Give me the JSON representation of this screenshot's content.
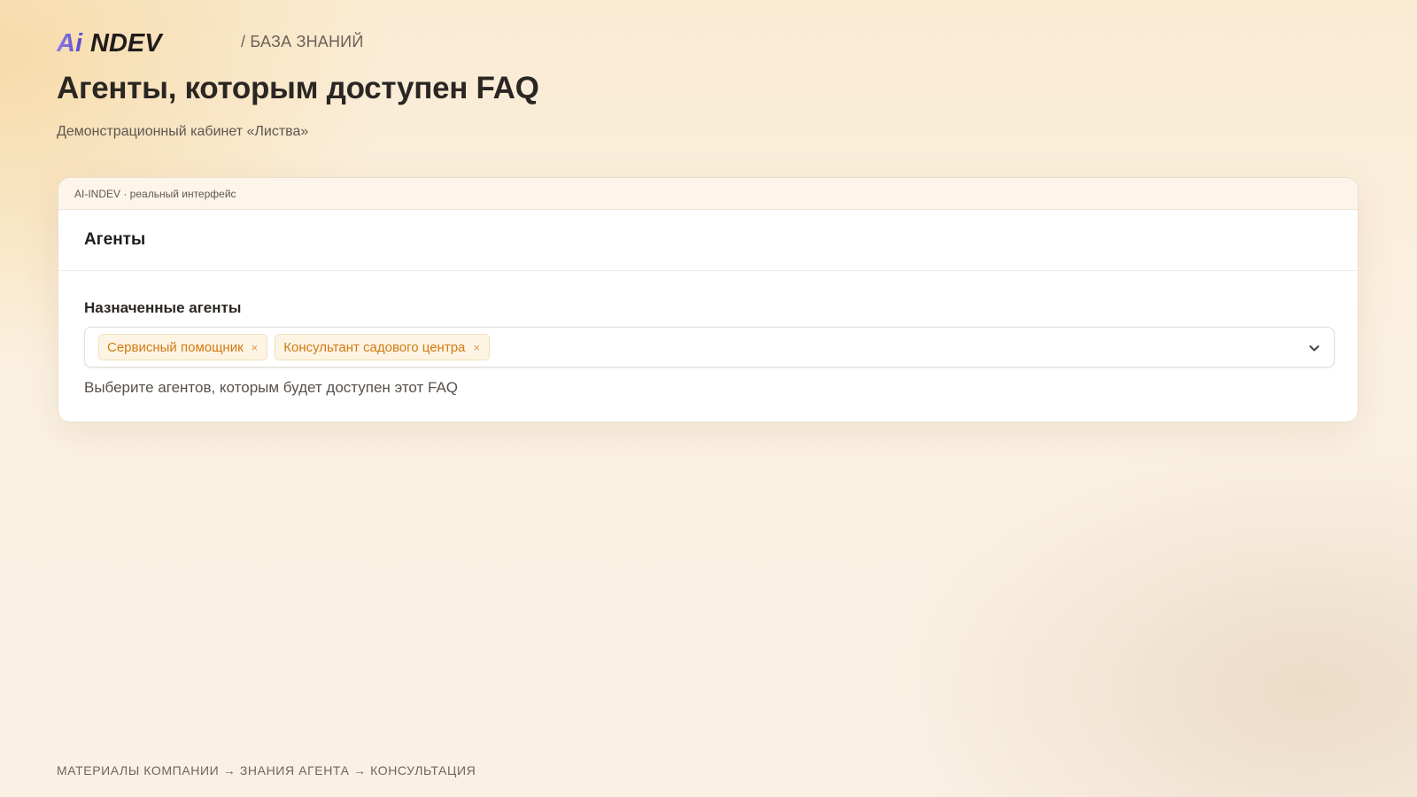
{
  "header": {
    "logo_text": "AiNDEV",
    "breadcrumb": "/ БАЗА ЗНАНИЙ"
  },
  "page": {
    "title": "Агенты, которым доступен FAQ",
    "subtitle": "Демонстрационный кабинет «Листва»"
  },
  "panel": {
    "topbar_label": "AI-INDEV · реальный интерфейс",
    "section_title": "Агенты",
    "field": {
      "label": "Назначенные агенты",
      "selected": [
        {
          "label": "Сервисный помощник",
          "remove_glyph": "×"
        },
        {
          "label": "Консультант садового центра",
          "remove_glyph": "×"
        }
      ],
      "hint": "Выберите агентов, которым будет доступен этот FAQ"
    }
  },
  "footer": {
    "flow": "МАТЕРИАЛЫ КОМПАНИИ → ЗНАНИЯ АГЕНТА → КОНСУЛЬТАЦИЯ"
  },
  "icons": {
    "dropdown": "chevron-down-icon",
    "tag_remove": "close-icon"
  },
  "colors": {
    "logo_accent": "#6a5bd6",
    "logo_dark": "#1f1c1a",
    "tag_text": "#d27a14",
    "tag_bg": "#fdf4e3"
  }
}
